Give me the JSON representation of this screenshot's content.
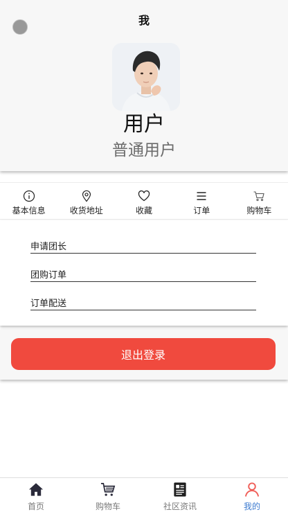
{
  "header": {
    "title": "我",
    "username": "用户",
    "user_type": "普通用户"
  },
  "menu": [
    {
      "label": "基本信息",
      "icon": "info-icon"
    },
    {
      "label": "收货地址",
      "icon": "location-icon"
    },
    {
      "label": "收藏",
      "icon": "heart-icon"
    },
    {
      "label": "订单",
      "icon": "list-icon"
    },
    {
      "label": "购物车",
      "icon": "cart-icon"
    }
  ],
  "links": [
    {
      "label": "申请团长"
    },
    {
      "label": "团购订单"
    },
    {
      "label": "订单配送"
    }
  ],
  "logout": {
    "label": "退出登录",
    "color": "#f04a3e"
  },
  "tabbar": {
    "items": [
      {
        "label": "首页",
        "icon": "home-icon",
        "active": false
      },
      {
        "label": "购物车",
        "icon": "cart-icon",
        "active": false
      },
      {
        "label": "社区资讯",
        "icon": "news-icon",
        "active": false
      },
      {
        "label": "我的",
        "icon": "user-icon",
        "active": true
      }
    ],
    "active_color": "#3d7bd0",
    "active_icon_color": "#f0605a"
  }
}
